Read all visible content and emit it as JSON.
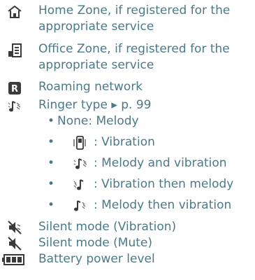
{
  "entries": [
    {
      "icon": "home-zone-icon",
      "lines": [
        "Home Zone, if registered for the",
        "appropriate service"
      ]
    },
    {
      "icon": "office-zone-icon",
      "lines": [
        "Office Zone, if registered for the",
        "appropriate service"
      ]
    },
    {
      "icon": "roaming-icon",
      "lines": [
        "Roaming network"
      ]
    },
    {
      "icon": "ringer-type-icon",
      "lines": [
        "Ringer type ▸ p. 99"
      ]
    }
  ],
  "ringer_options": [
    {
      "bullet": "•",
      "icon": "",
      "text": "None: Melody"
    },
    {
      "bullet": "•",
      "icon": "vibration-icon",
      "text": ": Vibration"
    },
    {
      "bullet": "•",
      "icon": "melody-vibration-icon",
      "text": ": Melody and vibration"
    },
    {
      "bullet": "•",
      "icon": "vibration-then-melody-icon",
      "text": ": Vibration then melody"
    },
    {
      "bullet": "•",
      "icon": "melody-then-vibration-icon",
      "text": ": Melody then vibration"
    }
  ],
  "tail_entries": [
    {
      "icon": "silent-vibration-icon",
      "text": "Silent mode (Vibration)"
    },
    {
      "icon": "silent-mute-icon",
      "text": "Silent mode (Mute)"
    },
    {
      "icon": "battery-icon",
      "text": "Battery power level"
    }
  ],
  "colors": {
    "text": "#4a7a87",
    "icon": "#3a3a3a"
  }
}
